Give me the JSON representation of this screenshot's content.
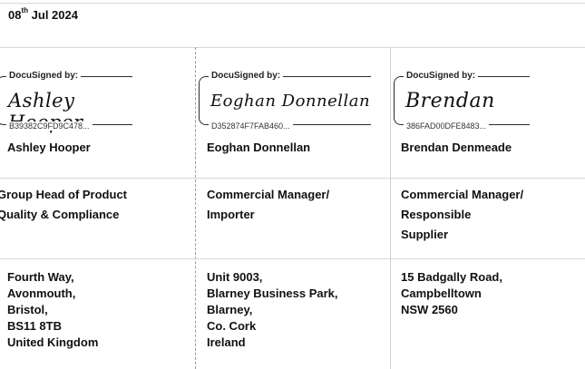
{
  "date": {
    "day": "08",
    "suffix": "th",
    "rest": "Jul 2024"
  },
  "docusign_label": "DocuSigned by:",
  "signatories": [
    {
      "signature": "Ashley Hooper",
      "envelope_id": "B39382C9FD9C478...",
      "name": "Ashley Hooper",
      "role": [
        "Group Head of Product",
        "Quality & Compliance"
      ],
      "address": [
        "Fourth Way,",
        "Avonmouth,",
        "Bristol,",
        "BS11 8TB",
        "United Kingdom"
      ]
    },
    {
      "signature": "Eoghan Donnellan",
      "envelope_id": "D352874F7FAB460...",
      "name": "Eoghan Donnellan",
      "role": [
        "Commercial Manager/",
        "Importer"
      ],
      "address": [
        "Unit 9003,",
        "Blarney Business Park,",
        "Blarney,",
        "Co. Cork",
        "Ireland"
      ]
    },
    {
      "signature": "Brendan",
      "envelope_id": "386FAD00DFE8483...",
      "name": "Brendan Denmeade",
      "role": [
        "Commercial Manager/",
        "Responsible",
        "Supplier"
      ],
      "address": [
        "15 Badgally Road,",
        "Campbelltown",
        "NSW 2560"
      ]
    }
  ]
}
